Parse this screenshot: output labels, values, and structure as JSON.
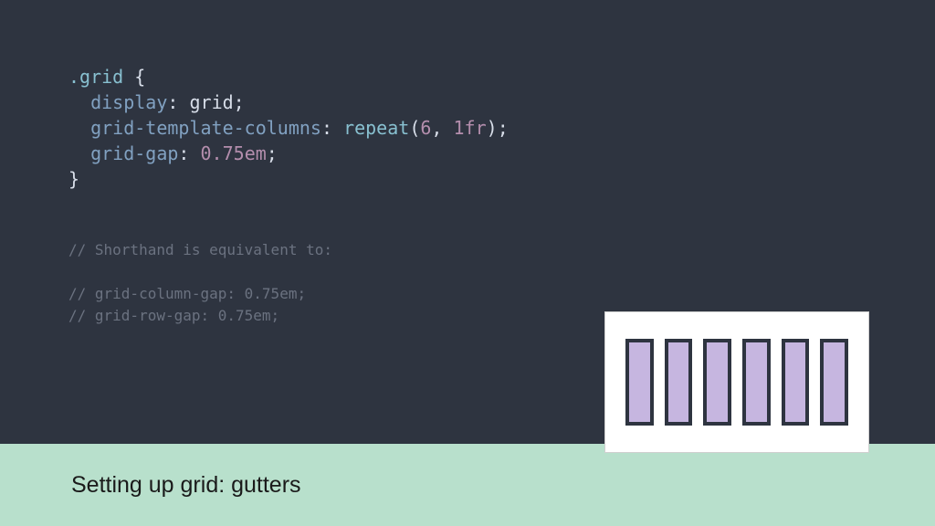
{
  "code": {
    "selector": ".grid",
    "open_brace": " {",
    "close_brace": "}",
    "indent": "  ",
    "props": [
      {
        "name": "display",
        "value_plain": "grid"
      },
      {
        "name": "grid-template-columns",
        "func": "repeat",
        "args": [
          {
            "num": "6"
          },
          {
            "num": "1",
            "unit": "fr"
          }
        ]
      },
      {
        "name": "grid-gap",
        "value_num": "0.75",
        "value_unit": "em"
      }
    ]
  },
  "comments": {
    "line1": "// Shorthand is equivalent to:",
    "blank": "",
    "line2": "// grid-column-gap: 0.75em;",
    "line3": "// grid-row-gap: 0.75em;"
  },
  "caption": "Setting up grid: gutters",
  "illustration": {
    "columns": 6
  }
}
